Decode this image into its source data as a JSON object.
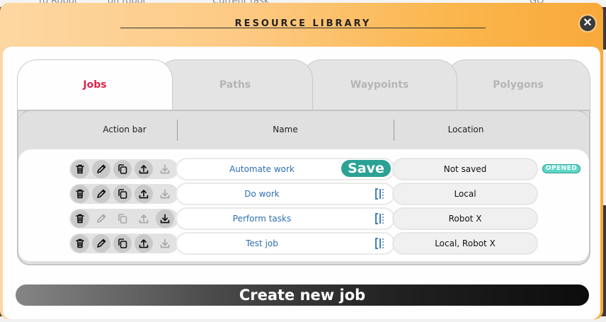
{
  "background": {
    "strip_items": [
      "to Robot",
      "on robot",
      "Current task",
      "GO"
    ]
  },
  "modal": {
    "title": "RESOURCE LIBRARY",
    "close_icon": "close-icon",
    "tabs": [
      {
        "label": "Jobs",
        "active": true
      },
      {
        "label": "Paths",
        "active": false
      },
      {
        "label": "Waypoints",
        "active": false
      },
      {
        "label": "Polygons",
        "active": false
      }
    ],
    "table": {
      "headers": {
        "action": "Action bar",
        "name": "Name",
        "location": "Location"
      },
      "rows": [
        {
          "name": "Automate work",
          "location": "Not saved",
          "has_save": true,
          "save_label": "Save",
          "badge": "OPENED",
          "upload_enabled": true,
          "download_enabled": false,
          "edit_enabled": true,
          "copy_enabled": true
        },
        {
          "name": "Do work",
          "location": "Local",
          "has_save": false,
          "badge": "",
          "upload_enabled": true,
          "download_enabled": false,
          "edit_enabled": true,
          "copy_enabled": true
        },
        {
          "name": "Perform tasks",
          "location": "Robot X",
          "has_save": false,
          "badge": "",
          "upload_enabled": false,
          "download_enabled": true,
          "edit_enabled": false,
          "copy_enabled": false
        },
        {
          "name": "Test job",
          "location": "Local, Robot X",
          "has_save": false,
          "badge": "",
          "upload_enabled": true,
          "download_enabled": false,
          "edit_enabled": true,
          "copy_enabled": true
        }
      ]
    },
    "create_button": "Create new job",
    "colors": {
      "accent_active_tab": "#e0224a",
      "save_button": "#2aa294",
      "opened_badge": "#5dd6c7",
      "link_text": "#2f6fae"
    }
  }
}
